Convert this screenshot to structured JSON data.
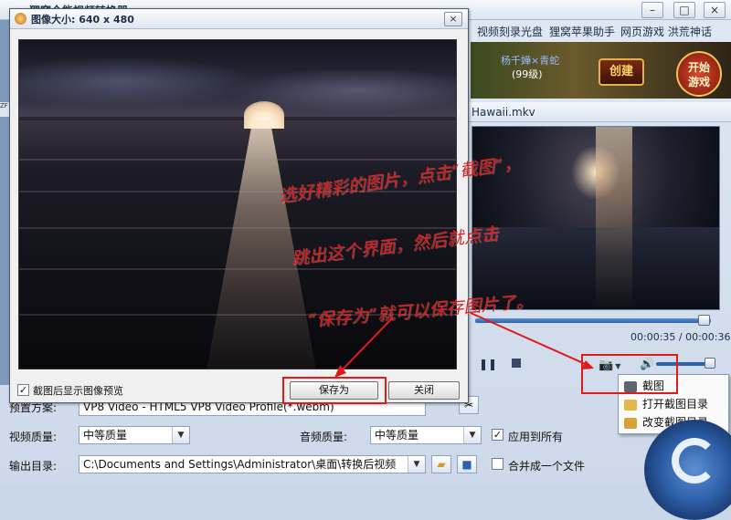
{
  "main_window": {
    "title": "狸窝全能视频转换器",
    "top_menu": [
      "视频刻录光盘",
      "狸窝苹果助手",
      "网页游戏 洪荒神话"
    ],
    "game_banner": {
      "character_name": "杨千嬅×青蛇",
      "character_level": "(99级)",
      "create_label": "创建",
      "start_label": "开始\n游戏"
    },
    "side_tab": "ZF"
  },
  "player": {
    "file_name": "Hawaii.mkv",
    "time": "00:00:35 / 00:00:36",
    "progress_fraction": 0.97,
    "volume_fraction": 0.8
  },
  "context_menu": {
    "items": [
      {
        "label": "截图",
        "icon": "camera-icon"
      },
      {
        "label": "打开截图目录",
        "icon": "folder-open-icon"
      },
      {
        "label": "改变截图目录",
        "icon": "folder-change-icon"
      }
    ]
  },
  "settings": {
    "preset_label": "预置方案:",
    "preset_value": "VP8 Video - HTML5 VP8 Video Profile(*.webm)",
    "video_quality_label": "视频质量:",
    "video_quality_value": "中等质量",
    "audio_quality_label": "音频质量:",
    "audio_quality_value": "中等质量",
    "apply_all_label": "应用到所有",
    "apply_all_checked": true,
    "output_dir_label": "输出目录:",
    "output_dir_value": "C:\\Documents and Settings\\Administrator\\桌面\\转换后视频",
    "merge_label": "合并成一个文件",
    "merge_checked": false
  },
  "snapshot_dialog": {
    "title": "图像大小: 640 x 480",
    "show_preview_label": "截图后显示图像预览",
    "show_preview_checked": true,
    "save_as_label": "保存为",
    "close_label": "关闭"
  },
  "annotation": {
    "line1": "选好精彩的图片，点击“截图”，",
    "line2": "跳出这个界面，然后就点击",
    "line3": "“保存为”就可以保存图片了。",
    "color": "#e21a1a"
  }
}
